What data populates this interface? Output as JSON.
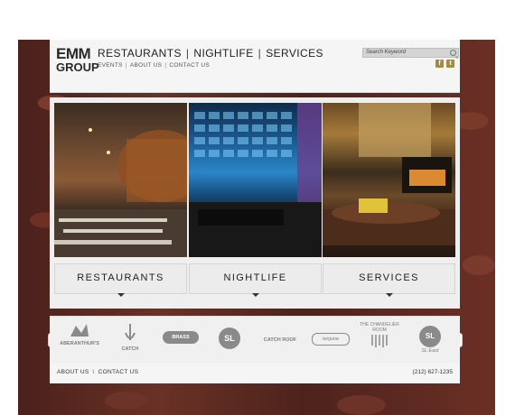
{
  "brand": {
    "logo_line1": "EMM",
    "logo_line2": "GROUP"
  },
  "main_nav": [
    {
      "label": "RESTAURANTS"
    },
    {
      "label": "NIGHTLIFE"
    },
    {
      "label": "SERVICES"
    }
  ],
  "nav_separator": "|",
  "sub_nav": [
    {
      "label": "EVENTS"
    },
    {
      "label": "ABOUT US"
    },
    {
      "label": "CONTACT US"
    }
  ],
  "search": {
    "placeholder": "Search Keyword"
  },
  "social": {
    "facebook": "f",
    "twitter": "t"
  },
  "panels": [
    {
      "label": "RESTAURANTS"
    },
    {
      "label": "NIGHTLIFE"
    },
    {
      "label": "SERVICES"
    }
  ],
  "brands": [
    {
      "label": "ABERANTHUR'S"
    },
    {
      "label": "CATCH"
    },
    {
      "label": "BRASS"
    },
    {
      "label": "SL"
    },
    {
      "label": "CATCH ROOF"
    },
    {
      "label": "tenjune"
    },
    {
      "label": "THE CHANDELIER ROOM"
    },
    {
      "label": "SL East"
    }
  ],
  "carousel": {
    "prev": "‹",
    "next": "›"
  },
  "footer": {
    "about": "ABOUT US",
    "separator": "\\",
    "contact": "CONTACT US",
    "phone": "(212) 627-1235"
  },
  "colors": {
    "brick": "#5a2a22",
    "accent": "#a08c4a",
    "panel_bg": "#ececec"
  }
}
